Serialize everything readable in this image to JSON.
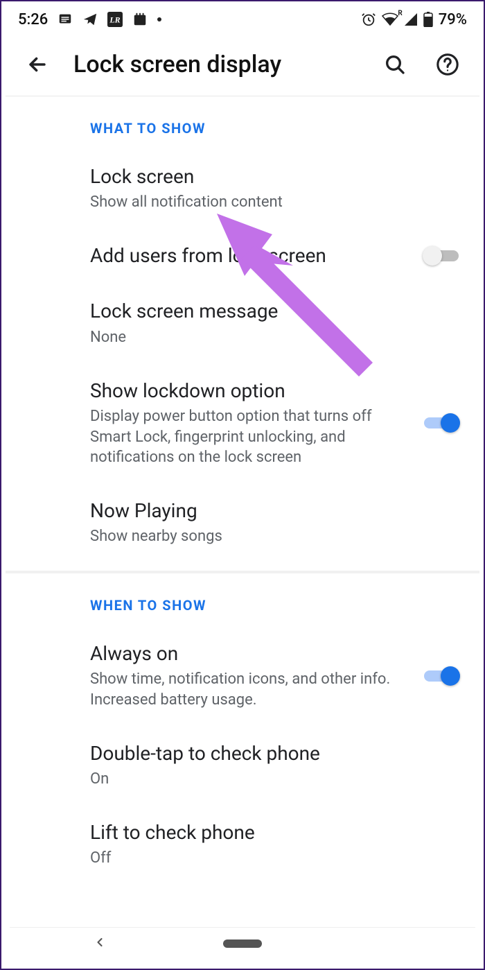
{
  "status": {
    "time": "5:26",
    "battery": "79%",
    "wifi_badge": "R"
  },
  "header": {
    "title": "Lock screen display"
  },
  "sections": [
    {
      "header": "WHAT TO SHOW",
      "rows": [
        {
          "title": "Lock screen",
          "subtitle": "Show all notification content"
        },
        {
          "title": "Add users from lock screen",
          "toggle": false
        },
        {
          "title": "Lock screen message",
          "subtitle": "None"
        },
        {
          "title": "Show lockdown option",
          "subtitle": "Display power button option that turns off Smart Lock, fingerprint unlocking, and notifications on the lock screen",
          "toggle": true
        },
        {
          "title": "Now Playing",
          "subtitle": "Show nearby songs"
        }
      ]
    },
    {
      "header": "WHEN TO SHOW",
      "rows": [
        {
          "title": "Always on",
          "subtitle": "Show time, notification icons, and other info. Increased battery usage.",
          "toggle": true
        },
        {
          "title": "Double-tap to check phone",
          "subtitle": "On"
        },
        {
          "title": "Lift to check phone",
          "subtitle": "Off"
        }
      ]
    }
  ],
  "annotation": {
    "color": "#c271e8"
  }
}
